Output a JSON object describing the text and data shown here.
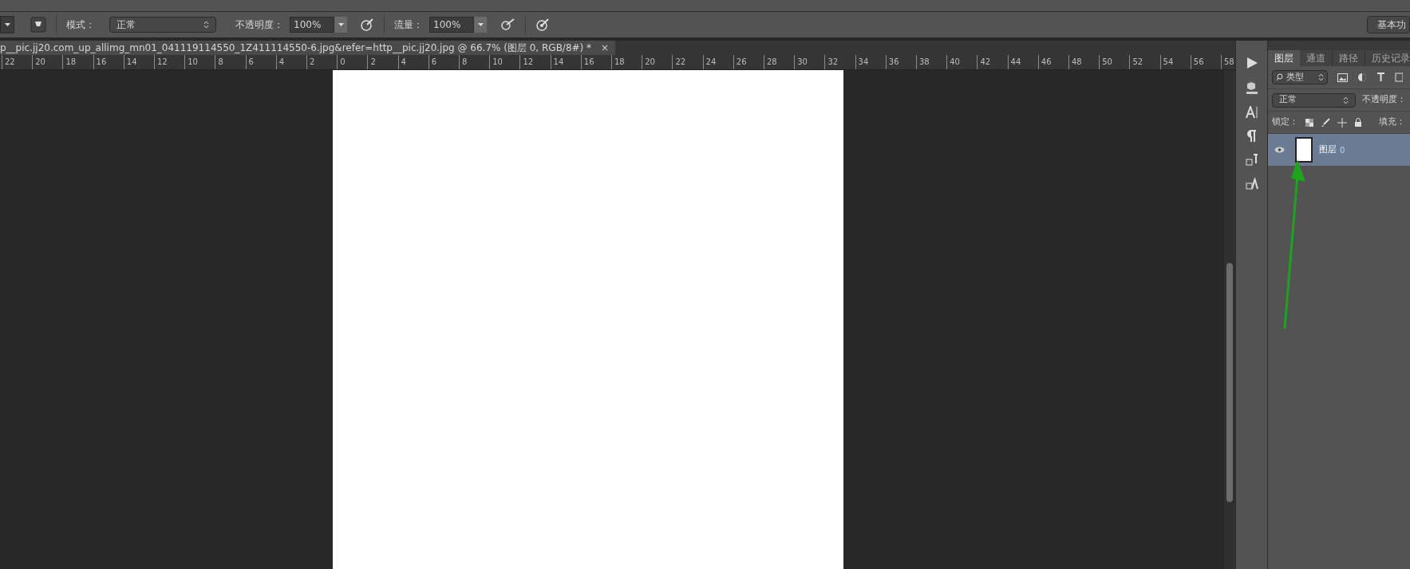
{
  "options_bar": {
    "mode_label": "模式：",
    "mode_value": "正常",
    "opacity_label": "不透明度：",
    "opacity_value": "100%",
    "flow_label": "流量：",
    "flow_value": "100%",
    "workspace_button": "基本功"
  },
  "document_tab": {
    "title": "p__pic.jj20.com_up_allimg_mn01_041119114550_1Z411114550-6.jpg&refer=http__pic.jj20.jpg @ 66.7% (图层 0, RGB/8#) *",
    "close": "×"
  },
  "ruler": {
    "labels": [
      "22",
      "20",
      "18",
      "16",
      "14",
      "12",
      "10",
      "8",
      "6",
      "4",
      "2",
      "0",
      "2",
      "4",
      "6",
      "8",
      "10",
      "12",
      "14",
      "16",
      "18",
      "20",
      "22",
      "24",
      "26",
      "28",
      "30",
      "32",
      "34",
      "36",
      "38",
      "40",
      "42",
      "44",
      "46",
      "48",
      "50",
      "52",
      "54",
      "56",
      "58"
    ]
  },
  "layers_panel": {
    "tabs": [
      {
        "label": "图层",
        "selected": true
      },
      {
        "label": "通道",
        "selected": false
      },
      {
        "label": "路径",
        "selected": false
      },
      {
        "label": "历史记录",
        "selected": false
      }
    ],
    "filter": "类型",
    "blend_mode": "正常",
    "opacity_label": "不透明度：",
    "lock_label": "锁定：",
    "fill_label": "填充：",
    "layers": [
      {
        "name": "图层",
        "suffix": "0",
        "selected": true,
        "visible": true
      }
    ]
  }
}
